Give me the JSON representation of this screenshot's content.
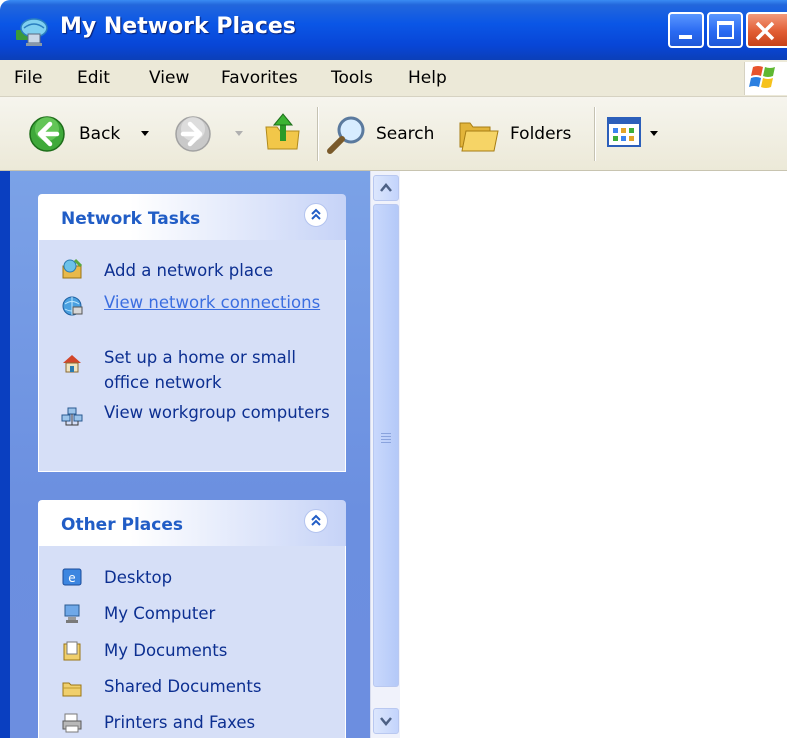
{
  "window": {
    "title": "My Network Places"
  },
  "menu": {
    "items": [
      "File",
      "Edit",
      "View",
      "Favorites",
      "Tools",
      "Help"
    ]
  },
  "toolbar": {
    "back_label": "Back",
    "search_label": "Search",
    "folders_label": "Folders"
  },
  "network_tasks": {
    "title": "Network Tasks",
    "items": [
      {
        "label": "Add a network place",
        "icon": "add-network-place-icon"
      },
      {
        "label": "View network connections",
        "icon": "network-connections-icon"
      },
      {
        "label": "Set up a home or small office network",
        "icon": "home-network-icon"
      },
      {
        "label": "View workgroup computers",
        "icon": "workgroup-computers-icon"
      }
    ]
  },
  "other_places": {
    "title": "Other Places",
    "items": [
      {
        "label": "Desktop",
        "icon": "desktop-icon"
      },
      {
        "label": "My Computer",
        "icon": "my-computer-icon"
      },
      {
        "label": "My Documents",
        "icon": "my-documents-icon"
      },
      {
        "label": "Shared Documents",
        "icon": "shared-documents-icon"
      },
      {
        "label": "Printers and Faxes",
        "icon": "printers-faxes-icon"
      }
    ]
  },
  "colors": {
    "titlebar": "#0a56e6",
    "task_pane": "#6b8fe0",
    "group_header_text": "#215dc6",
    "link_text": "#3b6ee0"
  }
}
